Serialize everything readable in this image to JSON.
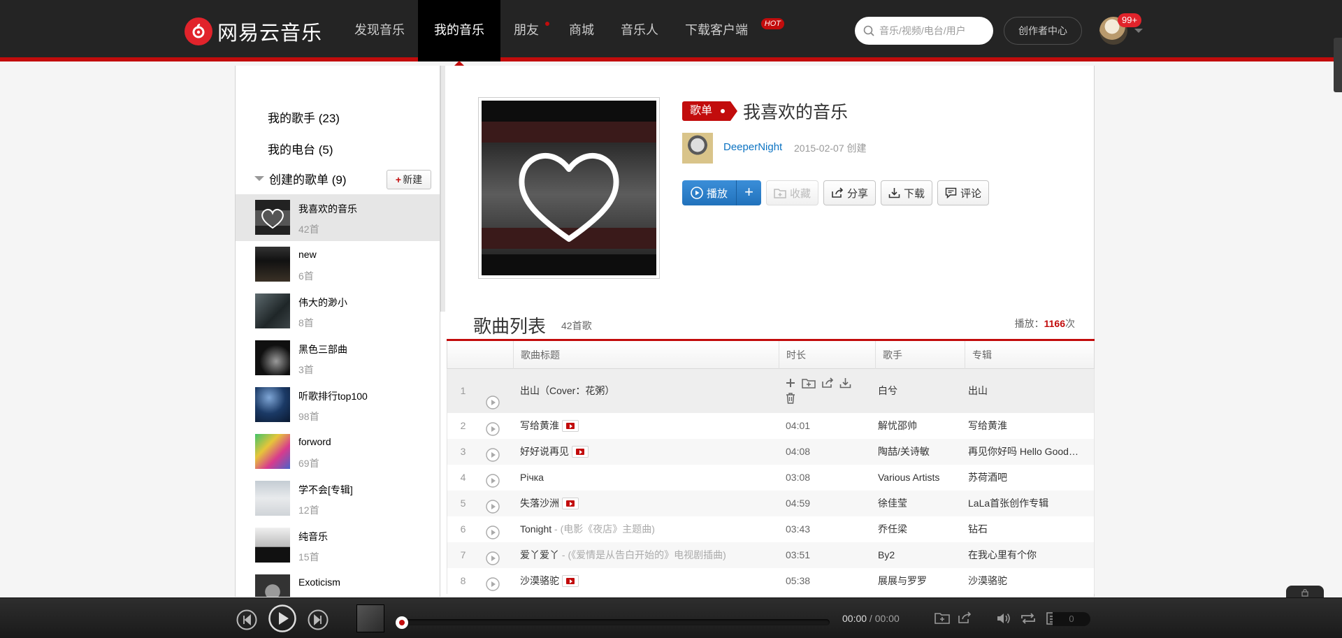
{
  "header": {
    "logo_text": "网易云音乐",
    "nav": [
      {
        "label": "发现音乐",
        "active": false,
        "dot": false,
        "hot": false
      },
      {
        "label": "我的音乐",
        "active": true,
        "dot": false,
        "hot": false
      },
      {
        "label": "朋友",
        "active": false,
        "dot": true,
        "hot": false
      },
      {
        "label": "商城",
        "active": false,
        "dot": false,
        "hot": false
      },
      {
        "label": "音乐人",
        "active": false,
        "dot": false,
        "hot": false
      },
      {
        "label": "下载客户端",
        "active": false,
        "dot": false,
        "hot": true
      }
    ],
    "hot_label": "HOT",
    "search_placeholder": "音乐/视频/电台/用户",
    "creator_center": "创作者中心",
    "msg_badge": "99+"
  },
  "sidebar": {
    "my_artists": "我的歌手 (23)",
    "my_radio": "我的电台 (5)",
    "created_playlists": "创建的歌单 (9)",
    "new_label": "新建",
    "playlists": [
      {
        "name": "我喜欢的音乐",
        "count": "42首",
        "active": true
      },
      {
        "name": "new",
        "count": "6首",
        "active": false
      },
      {
        "name": "伟大的渺小",
        "count": "8首",
        "active": false
      },
      {
        "name": "黑色三部曲",
        "count": "3首",
        "active": false
      },
      {
        "name": "听歌排行top100",
        "count": "98首",
        "active": false
      },
      {
        "name": "forword",
        "count": "69首",
        "active": false
      },
      {
        "name": "学不会[专辑]",
        "count": "12首",
        "active": false
      },
      {
        "name": "纯音乐",
        "count": "15首",
        "active": false
      },
      {
        "name": "Exoticism",
        "count": "",
        "active": false
      }
    ]
  },
  "playlist": {
    "tag": "歌单",
    "title": "我喜欢的音乐",
    "creator": "DeeperNight",
    "created": "2015-02-07 创建",
    "buttons": {
      "play": "播放",
      "collect": "收藏",
      "share": "分享",
      "download": "下载",
      "comment": "评论"
    }
  },
  "songs": {
    "section_title": "歌曲列表",
    "count_label": "42首歌",
    "play_label": "播放：",
    "play_count": "1166",
    "play_unit": "次",
    "headers": {
      "title": "歌曲标题",
      "duration": "时长",
      "artist": "歌手",
      "album": "专辑"
    },
    "rows": [
      {
        "idx": "1",
        "title": "出山（Cover：花粥）",
        "sub": "",
        "mv": false,
        "duration": "",
        "artist": "白兮",
        "album": "出山"
      },
      {
        "idx": "2",
        "title": "写给黄淮",
        "sub": "",
        "mv": true,
        "duration": "04:01",
        "artist": "解忧邵帅",
        "album": "写给黄淮"
      },
      {
        "idx": "3",
        "title": "好好说再见",
        "sub": "",
        "mv": true,
        "duration": "04:08",
        "artist": "陶喆/关诗敏",
        "album": "再见你好吗 Hello Goodbye"
      },
      {
        "idx": "4",
        "title": "Річка",
        "sub": "",
        "mv": false,
        "duration": "03:08",
        "artist": "Various Artists",
        "album": "苏荷酒吧"
      },
      {
        "idx": "5",
        "title": "失落沙洲",
        "sub": "",
        "mv": true,
        "duration": "04:59",
        "artist": "徐佳莹",
        "album": "LaLa首张创作专辑"
      },
      {
        "idx": "6",
        "title": "Tonight",
        "sub": " - (电影《夜店》主题曲)",
        "mv": false,
        "duration": "03:43",
        "artist": "乔任梁",
        "album": "钻石"
      },
      {
        "idx": "7",
        "title": "爱丫爱丫",
        "sub": " - (《爱情是从告白开始的》电视剧插曲)",
        "mv": false,
        "duration": "03:51",
        "artist": "By2",
        "album": "在我心里有个你"
      },
      {
        "idx": "8",
        "title": "沙漠骆驼",
        "sub": "",
        "mv": true,
        "duration": "05:38",
        "artist": "展展与罗罗",
        "album": "沙漠骆驼"
      }
    ]
  },
  "player": {
    "current": "00:00",
    "total": "00:00",
    "progress": 0,
    "playlist_count": "0"
  },
  "colors": {
    "accent": "#c20c0c",
    "topbar": "#242424",
    "link": "#0c73c2",
    "play_btn": "#2172bc"
  }
}
